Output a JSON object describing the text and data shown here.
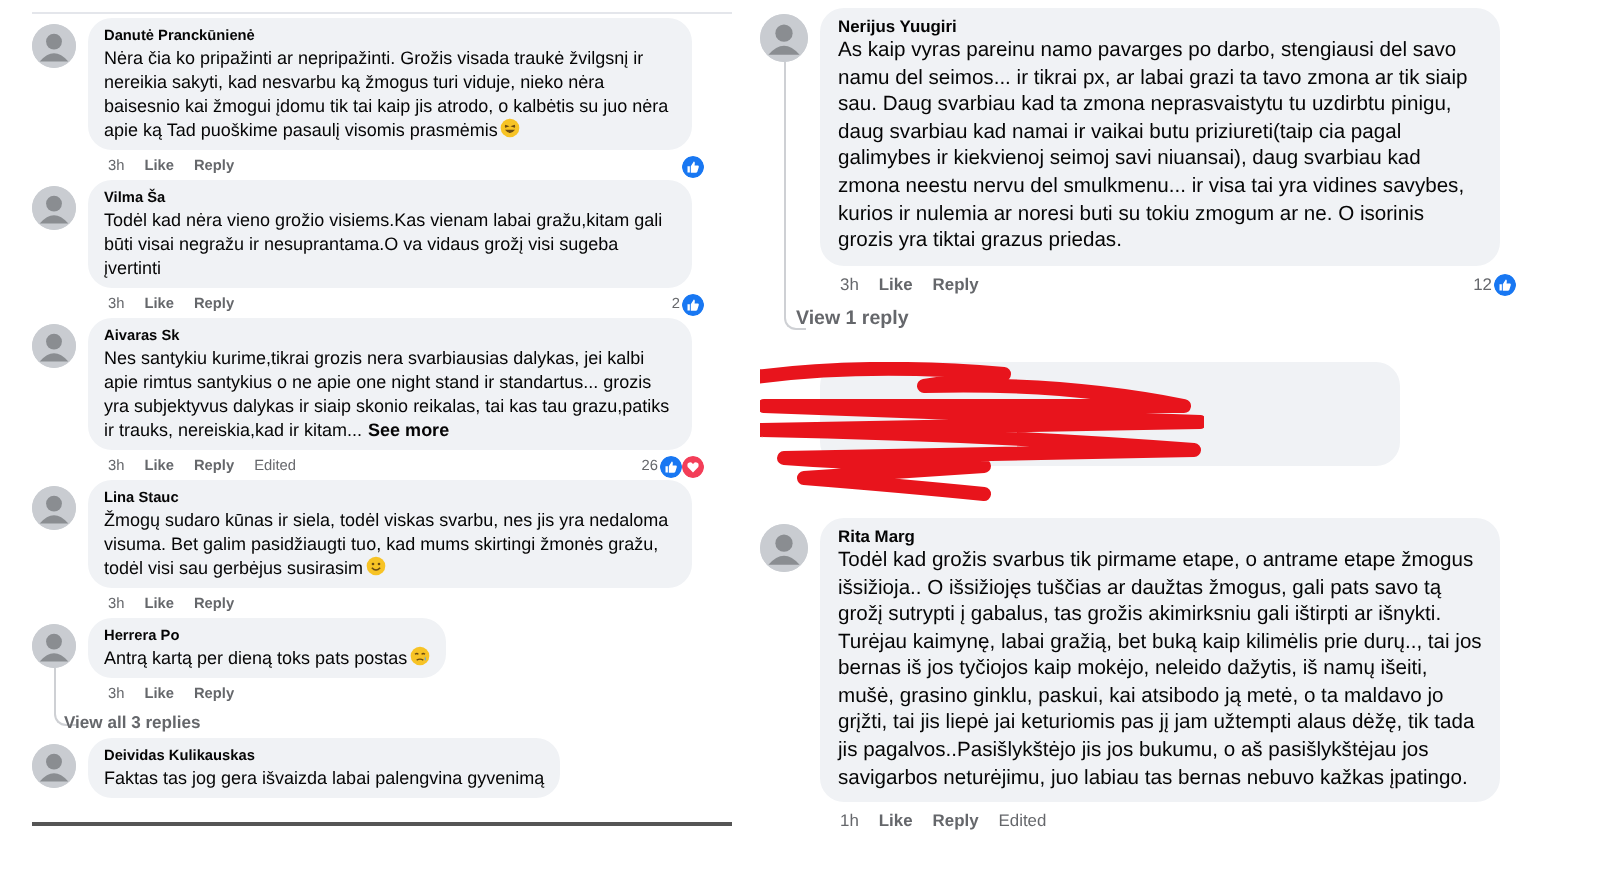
{
  "panels": [
    {
      "comments": [
        {
          "kind": "comment",
          "author": "Danutė Pranckūnienė",
          "text": "Nėra čia ko pripažinti ar nepripažinti. Grožis visada traukė žvilgsnį ir nereikia sakyti, kad nesvarbu ką žmogus turi viduje, nieko nėra baisesnio kai žmogui įdomu tik tai kaip jis atrodo, o kalbėtis su juo nėra apie ką Tad puoškime pasaulį visomis prasmėmis",
          "emoji": {
            "kind": "laugh"
          },
          "time": "3h",
          "like": "Like",
          "reply": "Reply",
          "reactions": [
            {
              "kind": "like"
            }
          ]
        },
        {
          "kind": "comment",
          "author": "Vilma Ša",
          "text": "Todėl kad nėra vieno grožio visiems.Kas vienam labai gražu,kitam gali būti visai negražu ir nesuprantama.O va vidaus grožį visi sugeba įvertinti",
          "time": "3h",
          "like": "Like",
          "reply": "Reply",
          "count": "2",
          "reactions": [
            {
              "kind": "like"
            }
          ]
        },
        {
          "kind": "comment",
          "author": "Aivaras Sk",
          "text": "Nes santykiu kurime,tikrai grozis nera svarbiausias dalykas, jei kalbi apie rimtus santykius o ne apie one night stand ir standartus... grozis yra subjektyvus dalykas ir siaip skonio reikalas, tai kas tau grazu,patiks ir trauks, nereiskia,kad ir kitam...",
          "see_more": "See more",
          "time": "3h",
          "like": "Like",
          "reply": "Reply",
          "edited": "Edited",
          "count": "26",
          "reactions": [
            {
              "kind": "like"
            },
            {
              "kind": "love"
            }
          ]
        },
        {
          "kind": "comment",
          "author": "Lina Stauc",
          "text": "Žmogų sudaro kūnas ir siela, todėl viskas svarbu, nes jis yra nedaloma visuma. Bet galim pasidžiaugti tuo, kad mums skirtingi žmonės gražu, todėl visi sau gerbėjus susirasim",
          "emoji": {
            "kind": "smile"
          },
          "time": "3h",
          "like": "Like",
          "reply": "Reply"
        },
        {
          "kind": "comment",
          "author": "Herrera Po",
          "text": "Antrą kartą per dieną toks pats postas",
          "emoji": {
            "kind": "tear"
          },
          "time": "3h",
          "like": "Like",
          "reply": "Reply",
          "replies_link": "View all 3 replies"
        },
        {
          "kind": "comment",
          "author": "Deividas Kulikauskas",
          "text": "Faktas tas jog gera išvaizda labai palengvina gyvenimą"
        }
      ]
    },
    {
      "comments": [
        {
          "kind": "comment",
          "author": "Nerijus Yuugiri",
          "text": "As kaip vyras pareinu namo pavarges po darbo, stengiausi del savo namu del seimos... ir tikrai px, ar labai grazi ta tavo zmona ar tik siaip sau. Daug svarbiau kad ta zmona neprasvaistytu tu uzdirbtu pinigu, daug svarbiau kad namai ir vaikai butu priziureti(taip cia pagal galimybes ir kiekvienoj seimoj savi niuansai), daug svarbiau kad zmona neestu nervu del smulkmenu... ir visa tai yra vidines savybes, kurios ir nulemia ar noresi buti su tokiu zmogum ar ne. O isorinis grozis yra tiktai grazus priedas.",
          "time": "3h",
          "like": "Like",
          "reply": "Reply",
          "count": "12",
          "reactions": [
            {
              "kind": "like"
            }
          ],
          "replies_link": "View 1 reply"
        },
        {
          "kind": "redacted"
        },
        {
          "kind": "comment",
          "author": "Rita Marg",
          "text": "Todėl kad grožis svarbus tik pirmame etape, o antrame etape žmogus išsižioja.. O išsižiojęs tuščias ar daužtas žmogus, gali pats savo tą grožį sutrypti į gabalus, tas grožis akimirksniu gali ištirpti ar išnykti. Turėjau kaimynę, labai gražią, bet buką kaip kilimėlis prie durų.., tai jos bernas iš jos tyčiojos kaip mokėjo, neleido dažytis, iš namų išeiti, mušė, grasino ginklu, paskui, kai atsibodo ją metė, o ta maldavo jo grįžti, tai jis liepė jai keturiomis pas jį jam užtempti alaus dėžę, tik tada jis pagalvos..Pasišlykštėjo jis jos bukumu, o aš pasišlykštėjau jos savigarbos neturėjimu, juo labiau tas bernas nebuvo kažkas įpatingo.",
          "time": "1h",
          "like": "Like",
          "reply": "Reply",
          "edited": "Edited"
        }
      ]
    }
  ]
}
